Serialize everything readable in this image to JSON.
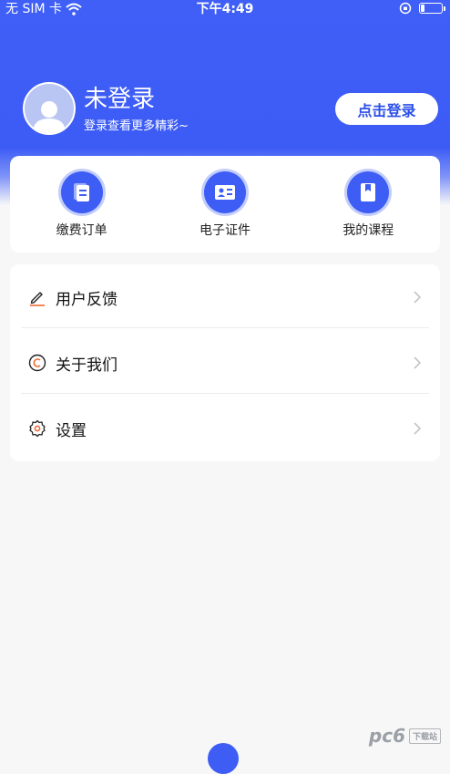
{
  "status_bar": {
    "carrier": "无 SIM 卡",
    "time": "下午4:49",
    "battery_level": 0.2
  },
  "profile": {
    "name": "未登录",
    "subtitle": "登录查看更多精彩~",
    "avatar_icon": "user-avatar-icon"
  },
  "login_button": {
    "label": "点击登录"
  },
  "quick_actions": [
    {
      "label": "缴费订单",
      "icon": "document-icon"
    },
    {
      "label": "电子证件",
      "icon": "id-card-icon"
    },
    {
      "label": "我的课程",
      "icon": "book-icon"
    }
  ],
  "menu": [
    {
      "label": "用户反馈",
      "icon": "pencil-icon"
    },
    {
      "label": "关于我们",
      "icon": "copyright-icon"
    },
    {
      "label": "设置",
      "icon": "gear-icon"
    }
  ],
  "watermark": {
    "text": "pc6",
    "badge": "下载站"
  },
  "colors": {
    "primary": "#3d5df5",
    "background": "#f7f7f8",
    "card": "#ffffff"
  }
}
